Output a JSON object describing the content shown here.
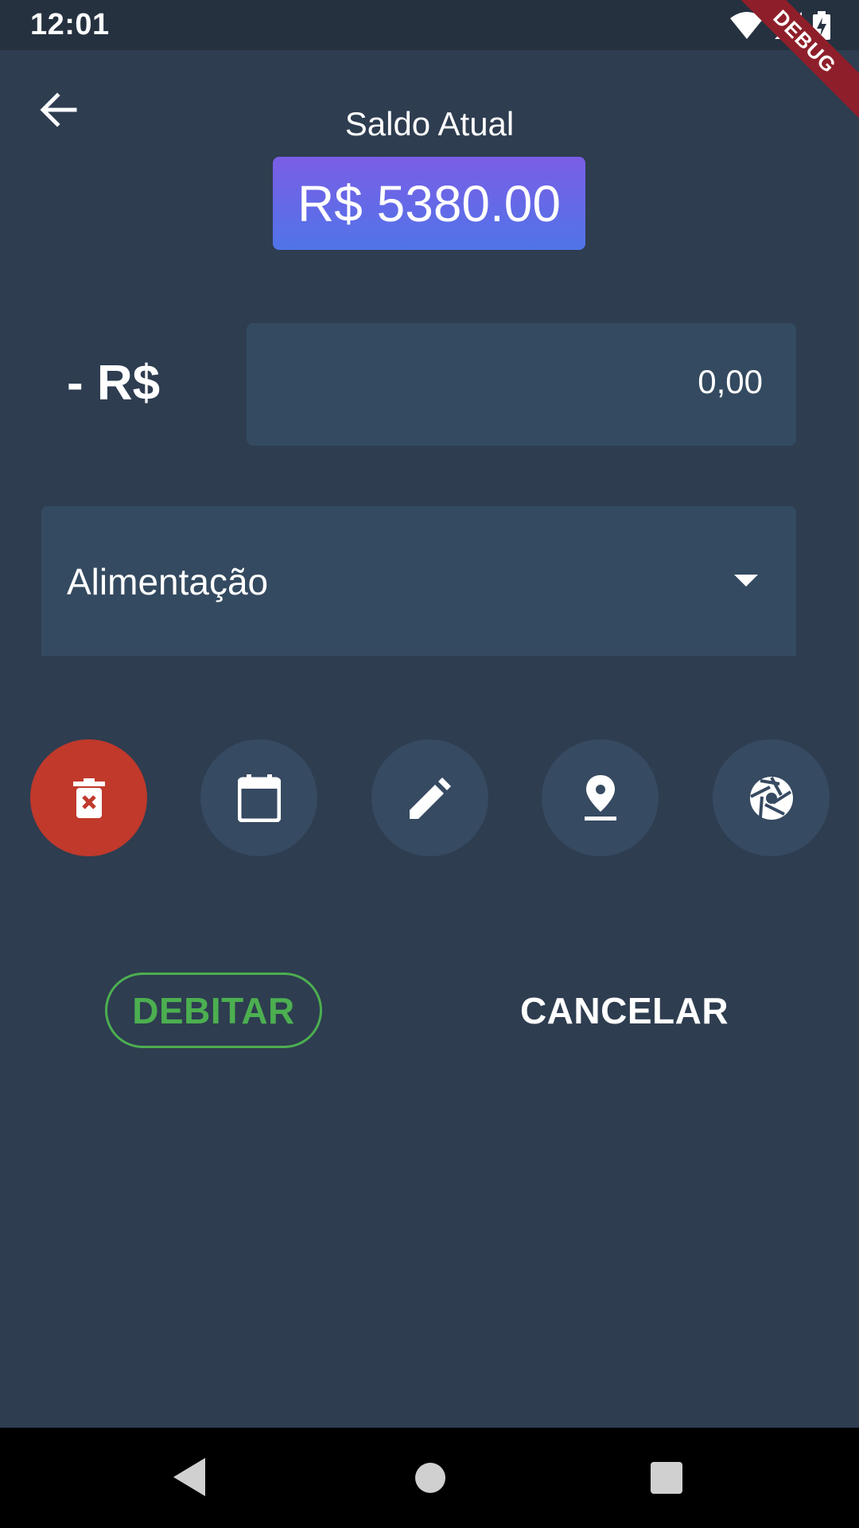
{
  "status_bar": {
    "time": "12:01",
    "debug_label": "DEBUG"
  },
  "header": {
    "balance_label": "Saldo Atual",
    "balance_value": "R$ 5380.00"
  },
  "form": {
    "currency_prefix": "- R$",
    "amount_value": "0,00",
    "category_selected": "Alimentação"
  },
  "actions": [
    {
      "icon": "delete-forever-icon"
    },
    {
      "icon": "calendar-icon"
    },
    {
      "icon": "edit-pencil-icon"
    },
    {
      "icon": "location-pin-icon"
    },
    {
      "icon": "camera-shutter-icon"
    }
  ],
  "buttons": {
    "debit": "DEBITAR",
    "cancel": "CANCELAR"
  },
  "colors": {
    "background": "#2e3d50",
    "field": "#344a60",
    "balance_gradient_start": "#7b5ee6",
    "balance_gradient_end": "#5074e8",
    "delete": "#c0392b",
    "debit": "#4caf50"
  }
}
